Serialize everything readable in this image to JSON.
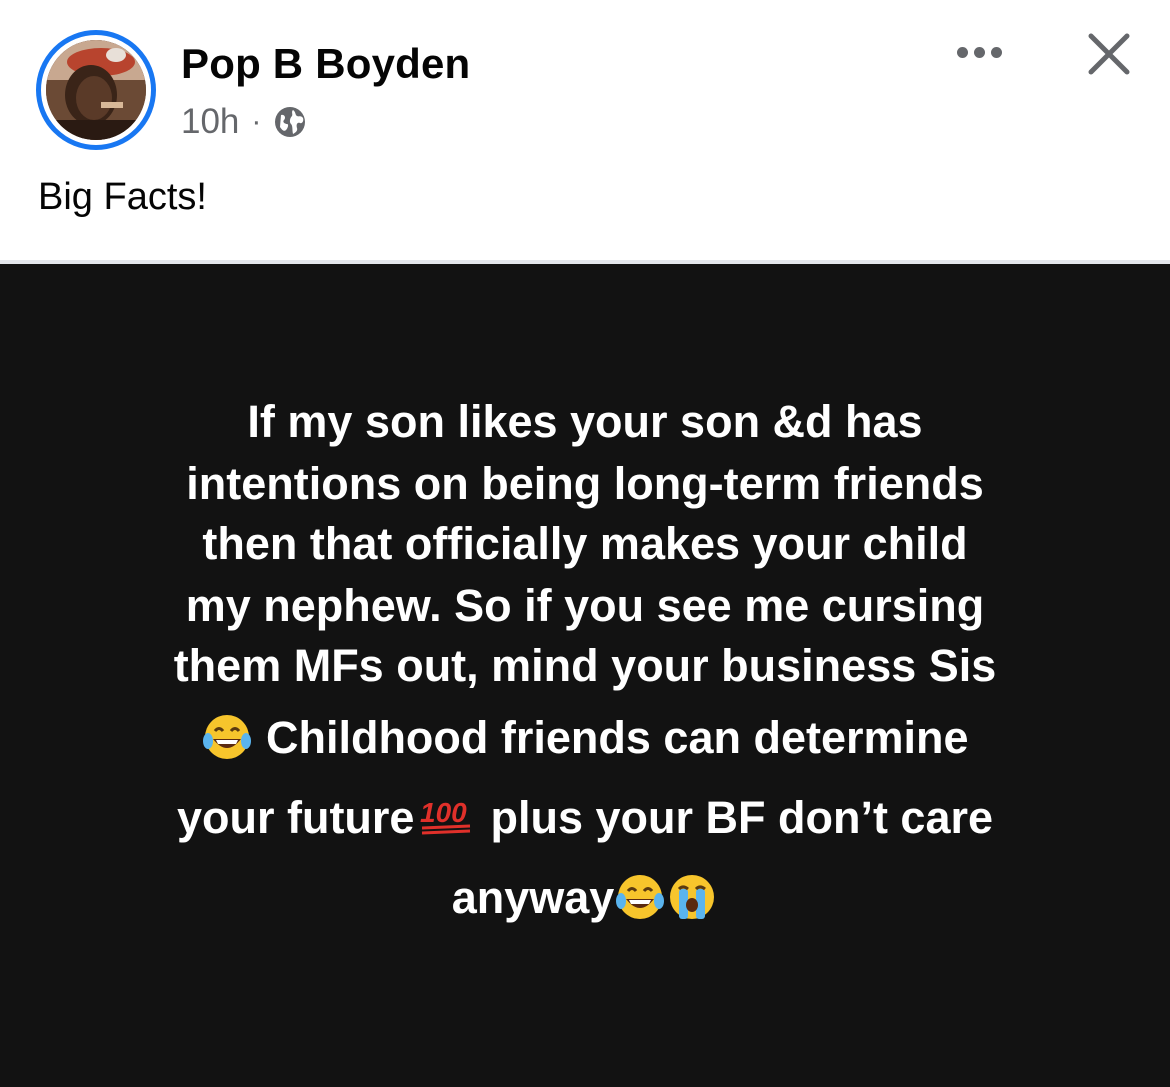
{
  "post": {
    "author_name": "Pop B Boyden",
    "time_ago": "10h",
    "separator": "·",
    "audience_icon": "globe-icon",
    "caption": "Big Facts!"
  },
  "actions": {
    "more_icon": "more-options-icon",
    "close_icon": "close-icon"
  },
  "image_text": {
    "line1": "If my son likes your son &d has",
    "line2": "intentions on being long-term friends",
    "line3": "then that officially makes your child",
    "line4": "my nephew. So if you see me cursing",
    "line5": "them MFs out, mind your business Sis",
    "line6": "Childhood friends can determine",
    "line7a": "your future",
    "line7b": "plus your BF don’t care",
    "line8": "anyway"
  },
  "colors": {
    "accent": "#1877f2",
    "text_primary": "#050505",
    "text_secondary": "#65676b",
    "image_background": "#121212"
  }
}
